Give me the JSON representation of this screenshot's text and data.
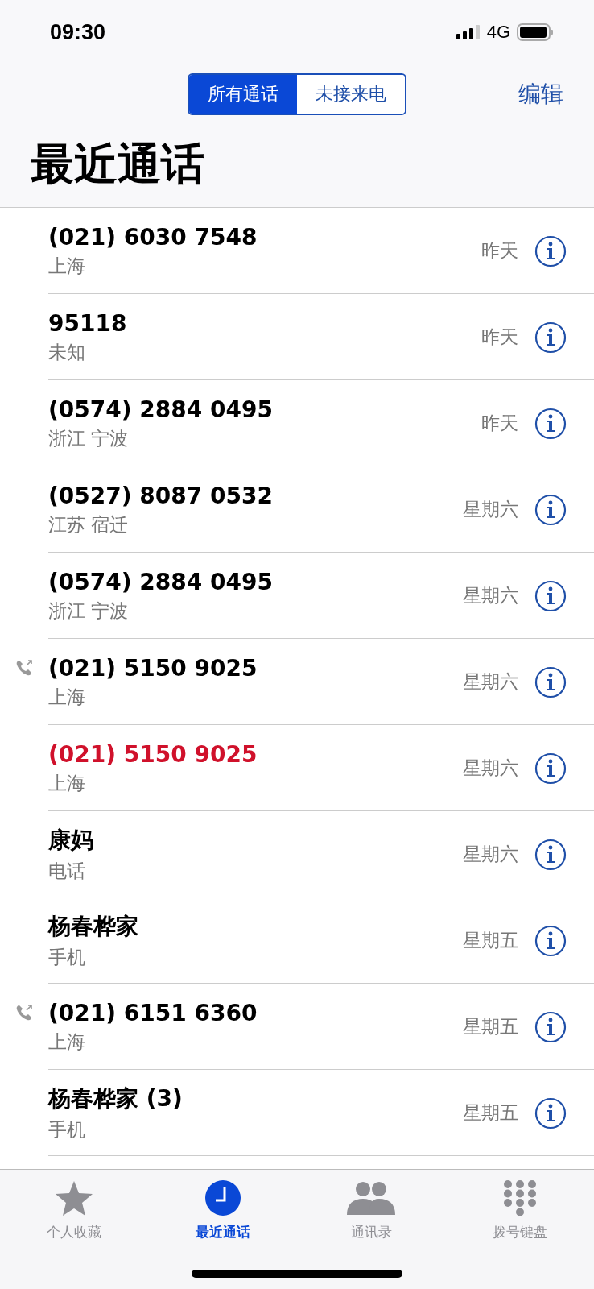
{
  "status_bar": {
    "time": "09:30",
    "network": "4G"
  },
  "segments": [
    {
      "label": "所有通话",
      "selected": true
    },
    {
      "label": "未接来电",
      "selected": false
    }
  ],
  "edit_button": "编辑",
  "title": "最近通话",
  "calls": [
    {
      "name": "(021) 6030 7548",
      "detail": "上海",
      "date": "昨天",
      "outgoing": false,
      "missed": false
    },
    {
      "name": "95118",
      "detail": "未知",
      "date": "昨天",
      "outgoing": false,
      "missed": false
    },
    {
      "name": "(0574) 2884 0495",
      "detail": "浙江 宁波",
      "date": "昨天",
      "outgoing": false,
      "missed": false
    },
    {
      "name": "(0527) 8087 0532",
      "detail": "江苏 宿迁",
      "date": "星期六",
      "outgoing": false,
      "missed": false
    },
    {
      "name": "(0574) 2884 0495",
      "detail": "浙江 宁波",
      "date": "星期六",
      "outgoing": false,
      "missed": false
    },
    {
      "name": "(021) 5150 9025",
      "detail": "上海",
      "date": "星期六",
      "outgoing": true,
      "missed": false
    },
    {
      "name": "(021) 5150 9025",
      "detail": "上海",
      "date": "星期六",
      "outgoing": false,
      "missed": true
    },
    {
      "name": "康妈",
      "detail": "电话",
      "date": "星期六",
      "outgoing": false,
      "missed": false
    },
    {
      "name": "杨春桦家",
      "detail": "手机",
      "date": "星期五",
      "outgoing": false,
      "missed": false
    },
    {
      "name": "(021) 6151 6360",
      "detail": "上海",
      "date": "星期五",
      "outgoing": true,
      "missed": false
    },
    {
      "name": "杨春桦家 (3)",
      "detail": "手机",
      "date": "星期五",
      "outgoing": false,
      "missed": false
    }
  ],
  "tab_bar": [
    {
      "kind": "star",
      "label": "个人收藏",
      "selected": false
    },
    {
      "kind": "clock",
      "label": "最近通话",
      "selected": true
    },
    {
      "kind": "contacts",
      "label": "通讯录",
      "selected": false
    },
    {
      "kind": "keypad",
      "label": "拨号键盘",
      "selected": false
    }
  ]
}
